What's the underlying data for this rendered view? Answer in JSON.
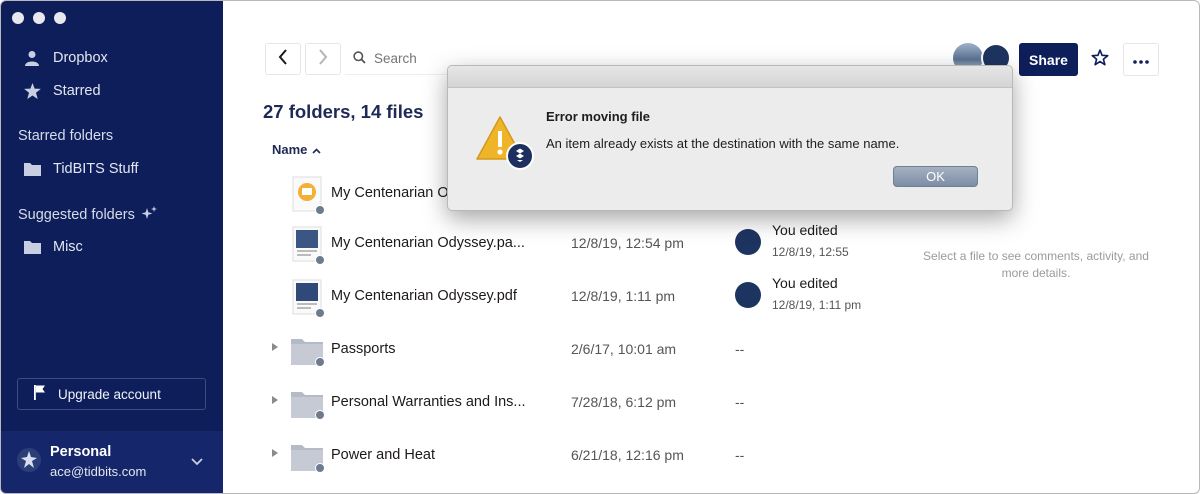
{
  "sidebar": {
    "nav": [
      {
        "label": "Dropbox",
        "icon": "person-icon"
      },
      {
        "label": "Starred",
        "icon": "star-icon"
      }
    ],
    "starred_heading": "Starred folders",
    "starred_items": [
      {
        "label": "TidBITS Stuff",
        "icon": "folder-icon"
      }
    ],
    "suggested_heading": "Suggested folders",
    "suggested_items": [
      {
        "label": "Misc",
        "icon": "folder-icon"
      }
    ],
    "upgrade_label": "Upgrade account",
    "account": {
      "name": "Personal",
      "email": "ace@tidbits.com"
    }
  },
  "toolbar": {
    "search_placeholder": "Search",
    "share_label": "Share"
  },
  "main": {
    "count_title": "27 folders, 14 files",
    "name_column": "Name",
    "rows": [
      {
        "name": "My Centenarian Odyssey",
        "date": "",
        "activity": "",
        "activity_sub": "",
        "type": "file"
      },
      {
        "name": "My Centenarian Odyssey.pa...",
        "date": "12/8/19, 12:54 pm",
        "activity": "You edited",
        "activity_sub": "12/8/19, 12:55",
        "type": "file"
      },
      {
        "name": "My Centenarian Odyssey.pdf",
        "date": "12/8/19, 1:11 pm",
        "activity": "You edited",
        "activity_sub": "12/8/19, 1:11 pm",
        "type": "file"
      },
      {
        "name": "Passports",
        "date": "2/6/17, 10:01 am",
        "activity": "--",
        "type": "folder"
      },
      {
        "name": "Personal Warranties and Ins...",
        "date": "7/28/18, 6:12 pm",
        "activity": "--",
        "type": "folder"
      },
      {
        "name": "Power and Heat",
        "date": "6/21/18, 12:16 pm",
        "activity": "--",
        "type": "folder"
      }
    ],
    "details_hint": "Select a file to see comments, activity, and more details."
  },
  "dialog": {
    "title": "Error moving file",
    "message": "An item already exists at the destination with the same name.",
    "ok_label": "OK"
  },
  "colors": {
    "sidebar_bg": "#0e1e5b",
    "accent": "#0e1e5b",
    "warning": "#f0b429"
  }
}
